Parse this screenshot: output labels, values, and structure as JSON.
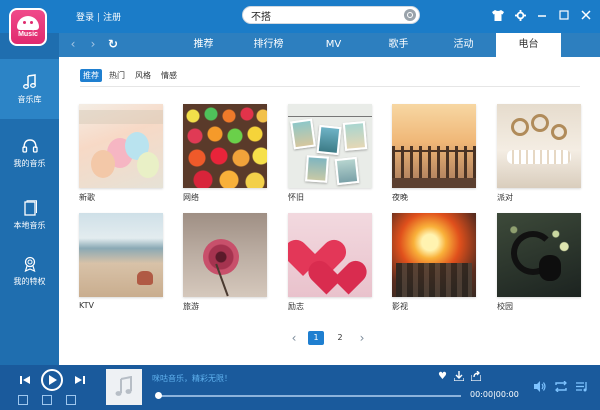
{
  "app": {
    "logo_text": "Music"
  },
  "header": {
    "login_label": "登录",
    "separator": "|",
    "register_label": "注册",
    "search_value": "不搭"
  },
  "tabs": [
    {
      "label": "推荐"
    },
    {
      "label": "排行榜"
    },
    {
      "label": "MV"
    },
    {
      "label": "歌手"
    },
    {
      "label": "活动"
    },
    {
      "label": "电台",
      "active": true
    }
  ],
  "sidebar": {
    "items": [
      {
        "label": "音乐库",
        "icon": "music-note-icon",
        "active": true
      },
      {
        "label": "我的音乐",
        "icon": "headphones-icon"
      },
      {
        "label": "本地音乐",
        "icon": "document-icon"
      },
      {
        "label": "我的特权",
        "icon": "badge-icon"
      }
    ]
  },
  "subtabs": [
    {
      "label": "推荐",
      "active": true
    },
    {
      "label": "热门"
    },
    {
      "label": "风格"
    },
    {
      "label": "情感"
    }
  ],
  "stations": [
    {
      "label": "新歌",
      "image": "balloons"
    },
    {
      "label": "网络",
      "image": "gummies"
    },
    {
      "label": "怀旧",
      "image": "photos"
    },
    {
      "label": "夜晚",
      "image": "fence-sunset"
    },
    {
      "label": "派对",
      "image": "lace-decoration"
    },
    {
      "label": "KTV",
      "image": "beach"
    },
    {
      "label": "旅游",
      "image": "flower"
    },
    {
      "label": "励志",
      "image": "hearts"
    },
    {
      "label": "影视",
      "image": "explosion"
    },
    {
      "label": "校园",
      "image": "headphones"
    }
  ],
  "pagination": {
    "pages": [
      "1",
      "2"
    ],
    "current": "1"
  },
  "player": {
    "song_title": "咪咕音乐，精彩无限！",
    "time": "00:00|00:00",
    "progress": 0
  },
  "colors": {
    "topbar": "#1b7cc8",
    "sidebar": "#1f6eaf",
    "bottombar": "#1a5a9c",
    "accent": "#1f7fd0"
  }
}
